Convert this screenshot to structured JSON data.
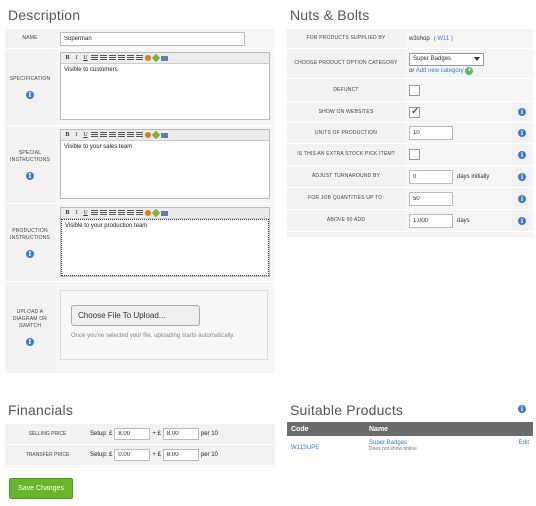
{
  "description": {
    "title": "Description",
    "name_label": "NAME",
    "name_value": "Superman",
    "specification_label": "SPECIFICATION",
    "specification_text": "Visible to customers",
    "special_instructions_label_1": "SPECIAL",
    "special_instructions_label_2": "INSTRUCTIONS",
    "special_instructions_text": "Visible to your sales team",
    "production_instructions_label_1": "PRODUCTION",
    "production_instructions_label_2": "INSTRUCTIONS",
    "production_instructions_text": "Visible to your production team",
    "upload_label_1": "UPLOAD A",
    "upload_label_2": "DIAGRAM OR",
    "upload_label_3": "SWATCH",
    "upload_button": "Choose File To Upload...",
    "upload_hint": "Once you've selected your file, uploading starts automatically."
  },
  "editor_toolbar": [
    "B",
    "I",
    "U"
  ],
  "nuts": {
    "title": "Nuts & Bolts",
    "supplied_by_label": "FOR PRODUCTS SUPPLIED BY",
    "supplied_by_value": "w3shop",
    "supplied_by_code": "( W11 )",
    "option_category_label": "CHOOSE PRODUCT OPTION CATEGORY",
    "option_category_value": "Super Badges",
    "option_or": "or",
    "add_category_link": "Add new category",
    "defunct_label": "DEFUNCT",
    "defunct_checked": false,
    "show_on_websites_label": "SHOW ON WEBSITES",
    "show_on_websites_checked": true,
    "units_label": "UNITS OF PRODUCTION",
    "units_value": "10",
    "extra_stock_label": "IS THIS AN EXTRA STOCK PICK ITEM?",
    "extra_stock_checked": false,
    "adjust_turnaround_label": "ADJUST TURNAROUND BY",
    "adjust_turnaround_value": "0",
    "adjust_turnaround_unit": "days initially",
    "job_quantities_label": "FOR JOB QUANTITIES UP TO:",
    "job_quantities_value": "50",
    "above_add_label": "ABOVE 50 ADD",
    "above_add_value": "1.000",
    "above_add_unit": "days"
  },
  "financials": {
    "title": "Financials",
    "selling_label": "SELLING PRICE",
    "transfer_label": "TRANSFER PRICE",
    "setup_text": "Setup: £",
    "plus_text": "+ £",
    "per_text": "per 10",
    "selling_setup": "8.00",
    "selling_unit": "8.00",
    "transfer_setup": "0.00",
    "transfer_unit": "8.00"
  },
  "suitable": {
    "title": "Suitable Products",
    "col_code": "Code",
    "col_name": "Name",
    "rows": [
      {
        "code": "W11SUPE",
        "name": "Super Badges",
        "note": "Does not show online",
        "action": "Edit"
      }
    ]
  },
  "save_button": "Save Changes",
  "colors": {
    "accent": "#3d7bc4",
    "save": "#69b62a",
    "panel": "#f2f2f2"
  }
}
